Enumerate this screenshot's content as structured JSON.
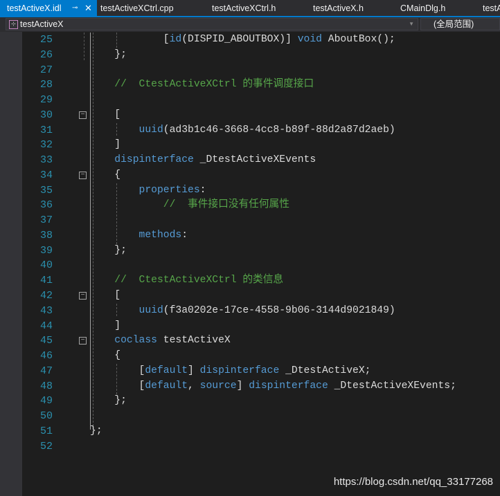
{
  "tabs": [
    {
      "label": "testActiveX.idl",
      "active": true
    },
    {
      "label": "testActiveXCtrl.cpp"
    },
    {
      "label": "testActiveXCtrl.h"
    },
    {
      "label": "testActiveX.h"
    },
    {
      "label": "CMainDlg.h"
    },
    {
      "label": "testA"
    }
  ],
  "tab_pin_icon": "⊸",
  "tab_close_icon": "✕",
  "nav": {
    "left": "testActiveX",
    "right": "(全局范围)"
  },
  "colors": {
    "keyword": "#569cd6",
    "comment": "#57a64a",
    "text": "#dcdcdc",
    "line_number": "#2b91af",
    "accent": "#007acc"
  },
  "lines": [
    {
      "n": "25",
      "t": [
        [
          "",
          "            ["
        ],
        [
          "k",
          "id"
        ],
        [
          "",
          "(DISPID_ABOUTBOX)] "
        ],
        [
          "k",
          "void"
        ],
        [
          "",
          " AboutBox();"
        ]
      ]
    },
    {
      "n": "26",
      "t": [
        [
          "",
          "    };"
        ]
      ]
    },
    {
      "n": "27",
      "t": []
    },
    {
      "n": "28",
      "t": [
        [
          "",
          "    "
        ],
        [
          "c",
          "//  CtestActiveXCtrl 的事件调度接口"
        ]
      ]
    },
    {
      "n": "29",
      "t": []
    },
    {
      "n": "30",
      "fold": true,
      "t": [
        [
          "",
          "    ["
        ]
      ]
    },
    {
      "n": "31",
      "t": [
        [
          "",
          "        "
        ],
        [
          "k",
          "uuid"
        ],
        [
          "",
          "(ad3b1c46-3668-4cc8-b89f-88d2a87d2aeb)"
        ]
      ]
    },
    {
      "n": "32",
      "t": [
        [
          "",
          "    ]"
        ]
      ]
    },
    {
      "n": "33",
      "t": [
        [
          "",
          "    "
        ],
        [
          "k",
          "dispinterface"
        ],
        [
          "",
          " _DtestActiveXEvents"
        ]
      ]
    },
    {
      "n": "34",
      "fold": true,
      "t": [
        [
          "",
          "    {"
        ]
      ]
    },
    {
      "n": "35",
      "t": [
        [
          "",
          "        "
        ],
        [
          "k",
          "properties"
        ],
        [
          "",
          ":"
        ]
      ]
    },
    {
      "n": "36",
      "t": [
        [
          "",
          "            "
        ],
        [
          "c",
          "//  事件接口没有任何属性"
        ]
      ]
    },
    {
      "n": "37",
      "t": []
    },
    {
      "n": "38",
      "t": [
        [
          "",
          "        "
        ],
        [
          "k",
          "methods"
        ],
        [
          "",
          ":"
        ]
      ]
    },
    {
      "n": "39",
      "t": [
        [
          "",
          "    };"
        ]
      ]
    },
    {
      "n": "40",
      "t": []
    },
    {
      "n": "41",
      "t": [
        [
          "",
          "    "
        ],
        [
          "c",
          "//  CtestActiveXCtrl 的类信息"
        ]
      ]
    },
    {
      "n": "42",
      "fold": true,
      "t": [
        [
          "",
          "    ["
        ]
      ]
    },
    {
      "n": "43",
      "t": [
        [
          "",
          "        "
        ],
        [
          "k",
          "uuid"
        ],
        [
          "",
          "(f3a0202e-17ce-4558-9b06-3144d9021849)"
        ]
      ]
    },
    {
      "n": "44",
      "t": [
        [
          "",
          "    ]"
        ]
      ]
    },
    {
      "n": "45",
      "fold": true,
      "t": [
        [
          "",
          "    "
        ],
        [
          "k",
          "coclass"
        ],
        [
          "",
          " testActiveX"
        ]
      ]
    },
    {
      "n": "46",
      "t": [
        [
          "",
          "    {"
        ]
      ]
    },
    {
      "n": "47",
      "t": [
        [
          "",
          "        ["
        ],
        [
          "k",
          "default"
        ],
        [
          "",
          "] "
        ],
        [
          "k",
          "dispinterface"
        ],
        [
          "",
          " _DtestActiveX;"
        ]
      ]
    },
    {
      "n": "48",
      "t": [
        [
          "",
          "        ["
        ],
        [
          "k",
          "default"
        ],
        [
          "",
          ", "
        ],
        [
          "k",
          "source"
        ],
        [
          "",
          "] "
        ],
        [
          "k",
          "dispinterface"
        ],
        [
          "",
          " _DtestActiveXEvents;"
        ]
      ]
    },
    {
      "n": "49",
      "t": [
        [
          "",
          "    };"
        ]
      ]
    },
    {
      "n": "50",
      "t": []
    },
    {
      "n": "51",
      "t": [
        [
          "",
          "};"
        ]
      ]
    },
    {
      "n": "52",
      "t": []
    }
  ],
  "fold_icon": "−",
  "watermark": "https://blog.csdn.net/qq_33177268"
}
